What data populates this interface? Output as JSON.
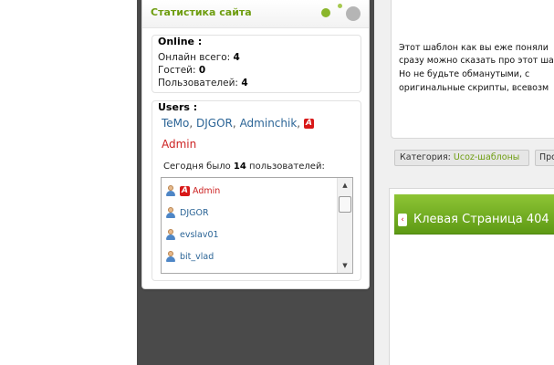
{
  "stats": {
    "title": "Статистика сайта",
    "online": {
      "heading": "Online :",
      "total_label": "Онлайн всего:",
      "total_value": "4",
      "guests_label": "Гостей:",
      "guests_value": "0",
      "users_label": "Пользователей:",
      "users_value": "4"
    },
    "users": {
      "heading": "Users :",
      "online_names": [
        "TeMo",
        "DJGOR",
        "Adminchik",
        "Admin"
      ],
      "separator": ",",
      "admin_badge": "A",
      "today_prefix": "Сегодня было",
      "today_count": "14",
      "today_suffix": "пользователей:",
      "list": [
        {
          "name": "Admin",
          "role": "admin"
        },
        {
          "name": "DJGOR",
          "role": "user"
        },
        {
          "name": "evslav01",
          "role": "user"
        },
        {
          "name": "bit_vlad",
          "role": "user"
        }
      ]
    }
  },
  "article": {
    "lines": [
      "Этот шаблон как вы еже поняли",
      "сразу можно сказать про этот ша",
      "Но  не  будьте  обманутыми,  с",
      "оригинальные скрипты, всевозм"
    ],
    "category_label": "Категория:",
    "category_value": "Ucoz-шаблоны",
    "next_label": "Про"
  },
  "next_article": {
    "title": "Клевая Страница 404"
  },
  "icons": {
    "scroll_up": "▲",
    "scroll_down": "▼",
    "arrow": "‹"
  }
}
